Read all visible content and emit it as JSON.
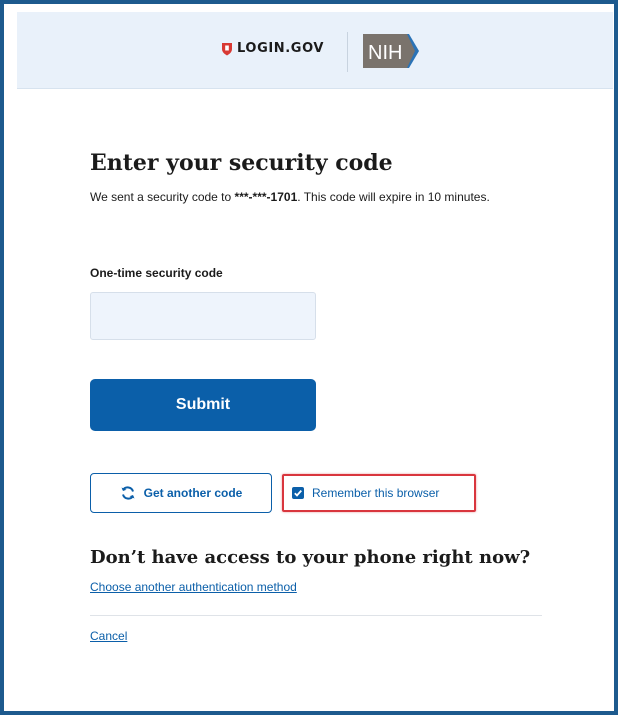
{
  "header": {
    "brand_text": "LOGIN.GOV",
    "partner_logo_text": "NIH",
    "partner_logo_color": "#7a736c",
    "partner_chevron_color": "#2b73b6",
    "shield_color": "#d83933"
  },
  "main": {
    "title": "Enter your security code",
    "description_prefix": "We sent a security code to",
    "masked_phone": "***-***-1701",
    "description_suffix": ". This code will expire in 10 minutes.",
    "field_label": "One-time security code",
    "code_value": "",
    "submit_label": "Submit",
    "another_code_label": "Get another code",
    "remember_label": "Remember this browser",
    "remember_checked": true,
    "subtitle": "Don’t have access to your phone right now?",
    "choose_method_link": "Choose another authentication method",
    "cancel_link": "Cancel"
  },
  "colors": {
    "primary": "#0b5fa9",
    "header_bg": "#e9f1fa",
    "frame_border": "#1d5a8e",
    "highlight_border": "#d9363e"
  }
}
